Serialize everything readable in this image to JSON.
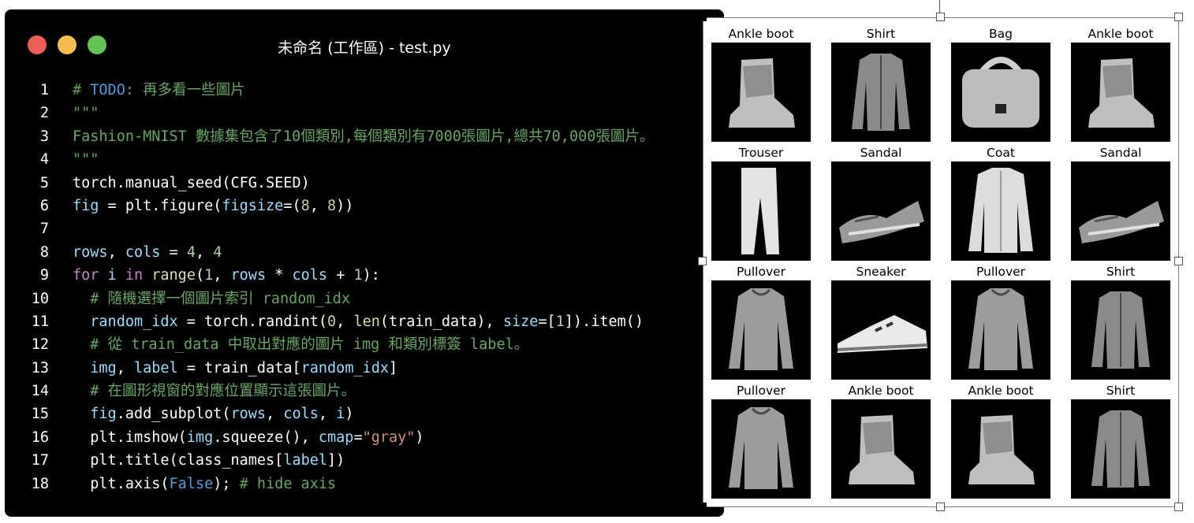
{
  "window": {
    "title": "未命名 (工作區) - test.py"
  },
  "code": {
    "lines": [
      {
        "n": "1",
        "tokens": [
          {
            "t": "# ",
            "c": "comment"
          },
          {
            "t": "TODO",
            "c": "todo"
          },
          {
            "t": ": 再多看一些圖片",
            "c": "comment"
          }
        ]
      },
      {
        "n": "2",
        "tokens": [
          {
            "t": "\"\"\"",
            "c": "string"
          }
        ]
      },
      {
        "n": "3",
        "tokens": [
          {
            "t": "Fashion-MNIST 數據集包含了10個類別,每個類別有7000張圖片,總共70,000張圖片。",
            "c": "string"
          }
        ]
      },
      {
        "n": "4",
        "tokens": [
          {
            "t": "\"\"\"",
            "c": "string"
          }
        ]
      },
      {
        "n": "5",
        "tokens": [
          {
            "t": "torch.manual_seed(CFG.SEED)",
            "c": "default"
          }
        ]
      },
      {
        "n": "6",
        "tokens": [
          {
            "t": "fig",
            "c": "var"
          },
          {
            "t": " = plt.figure(",
            "c": "default"
          },
          {
            "t": "figsize",
            "c": "var"
          },
          {
            "t": "=(",
            "c": "default"
          },
          {
            "t": "8",
            "c": "number"
          },
          {
            "t": ", ",
            "c": "default"
          },
          {
            "t": "8",
            "c": "number"
          },
          {
            "t": "))",
            "c": "default"
          }
        ]
      },
      {
        "n": "7",
        "tokens": []
      },
      {
        "n": "8",
        "tokens": [
          {
            "t": "rows",
            "c": "var"
          },
          {
            "t": ", ",
            "c": "default"
          },
          {
            "t": "cols",
            "c": "var"
          },
          {
            "t": " = ",
            "c": "default"
          },
          {
            "t": "4",
            "c": "number"
          },
          {
            "t": ", ",
            "c": "default"
          },
          {
            "t": "4",
            "c": "number"
          }
        ]
      },
      {
        "n": "9",
        "tokens": [
          {
            "t": "for",
            "c": "keyword"
          },
          {
            "t": " ",
            "c": "default"
          },
          {
            "t": "i",
            "c": "var"
          },
          {
            "t": " ",
            "c": "default"
          },
          {
            "t": "in",
            "c": "keyword"
          },
          {
            "t": " ",
            "c": "default"
          },
          {
            "t": "range",
            "c": "func"
          },
          {
            "t": "(",
            "c": "default"
          },
          {
            "t": "1",
            "c": "number"
          },
          {
            "t": ", ",
            "c": "default"
          },
          {
            "t": "rows",
            "c": "var"
          },
          {
            "t": " * ",
            "c": "default"
          },
          {
            "t": "cols",
            "c": "var"
          },
          {
            "t": " + ",
            "c": "default"
          },
          {
            "t": "1",
            "c": "number"
          },
          {
            "t": "):",
            "c": "default"
          }
        ]
      },
      {
        "n": "10",
        "tokens": [
          {
            "t": "  # 隨機選擇一個圖片索引 random_idx",
            "c": "comment"
          }
        ]
      },
      {
        "n": "11",
        "tokens": [
          {
            "t": "  ",
            "c": "default"
          },
          {
            "t": "random_idx",
            "c": "var"
          },
          {
            "t": " = torch.randint(",
            "c": "default"
          },
          {
            "t": "0",
            "c": "number"
          },
          {
            "t": ", ",
            "c": "default"
          },
          {
            "t": "len",
            "c": "func"
          },
          {
            "t": "(train_data), ",
            "c": "default"
          },
          {
            "t": "size",
            "c": "var"
          },
          {
            "t": "=[",
            "c": "default"
          },
          {
            "t": "1",
            "c": "number"
          },
          {
            "t": "]).item()",
            "c": "default"
          }
        ]
      },
      {
        "n": "12",
        "tokens": [
          {
            "t": "  # 從 train_data 中取出對應的圖片 img 和類別標簽 label。",
            "c": "comment"
          }
        ]
      },
      {
        "n": "13",
        "tokens": [
          {
            "t": "  ",
            "c": "default"
          },
          {
            "t": "img",
            "c": "var"
          },
          {
            "t": ", ",
            "c": "default"
          },
          {
            "t": "label",
            "c": "var"
          },
          {
            "t": " = train_data[",
            "c": "default"
          },
          {
            "t": "random_idx",
            "c": "var"
          },
          {
            "t": "]",
            "c": "default"
          }
        ]
      },
      {
        "n": "14",
        "tokens": [
          {
            "t": "  # 在圖形視窗的對應位置顯示這張圖片。",
            "c": "comment"
          }
        ]
      },
      {
        "n": "15",
        "tokens": [
          {
            "t": "  ",
            "c": "default"
          },
          {
            "t": "fig",
            "c": "var"
          },
          {
            "t": ".add_subplot(",
            "c": "default"
          },
          {
            "t": "rows",
            "c": "var"
          },
          {
            "t": ", ",
            "c": "default"
          },
          {
            "t": "cols",
            "c": "var"
          },
          {
            "t": ", ",
            "c": "default"
          },
          {
            "t": "i",
            "c": "var"
          },
          {
            "t": ")",
            "c": "default"
          }
        ]
      },
      {
        "n": "16",
        "tokens": [
          {
            "t": "  plt.imshow(",
            "c": "default"
          },
          {
            "t": "img",
            "c": "var"
          },
          {
            "t": ".squeeze(), ",
            "c": "default"
          },
          {
            "t": "cmap",
            "c": "var"
          },
          {
            "t": "=",
            "c": "default"
          },
          {
            "t": "\"gray\"",
            "c": "str2"
          },
          {
            "t": ")",
            "c": "default"
          }
        ]
      },
      {
        "n": "17",
        "tokens": [
          {
            "t": "  plt.title(class_names[",
            "c": "default"
          },
          {
            "t": "label",
            "c": "var"
          },
          {
            "t": "])",
            "c": "default"
          }
        ]
      },
      {
        "n": "18",
        "tokens": [
          {
            "t": "  plt.axis(",
            "c": "default"
          },
          {
            "t": "False",
            "c": "const"
          },
          {
            "t": "); ",
            "c": "default"
          },
          {
            "t": "# hide axis",
            "c": "comment"
          }
        ]
      }
    ]
  },
  "figure": {
    "cells": [
      {
        "title": "Ankle boot",
        "icon": "ankle-boot-image"
      },
      {
        "title": "Shirt",
        "icon": "shirt-image"
      },
      {
        "title": "Bag",
        "icon": "bag-image"
      },
      {
        "title": "Ankle boot",
        "icon": "ankle-boot-image"
      },
      {
        "title": "Trouser",
        "icon": "trouser-image"
      },
      {
        "title": "Sandal",
        "icon": "sandal-image"
      },
      {
        "title": "Coat",
        "icon": "coat-image"
      },
      {
        "title": "Sandal",
        "icon": "sandal-image"
      },
      {
        "title": "Pullover",
        "icon": "pullover-image"
      },
      {
        "title": "Sneaker",
        "icon": "sneaker-image"
      },
      {
        "title": "Pullover",
        "icon": "pullover-image"
      },
      {
        "title": "Shirt",
        "icon": "shirt-image"
      },
      {
        "title": "Pullover",
        "icon": "pullover-image"
      },
      {
        "title": "Ankle boot",
        "icon": "ankle-boot-image"
      },
      {
        "title": "Ankle boot",
        "icon": "ankle-boot-image"
      },
      {
        "title": "Shirt",
        "icon": "shirt-image"
      }
    ]
  },
  "colors": {
    "window_bg": "#000000",
    "close": "#ec5f57",
    "minimize": "#f5bd4f",
    "zoom": "#61c454",
    "comment": "#67a663",
    "variable": "#9cdcfe"
  }
}
